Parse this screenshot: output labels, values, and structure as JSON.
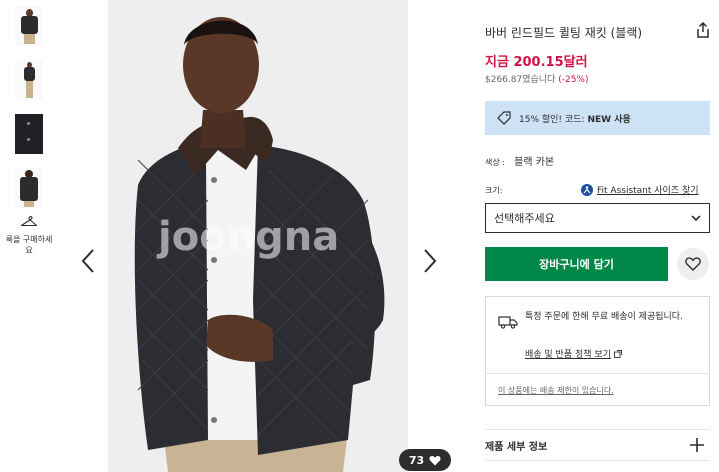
{
  "gallery": {
    "thumbnails": [
      {
        "alt": "thumbnail-front"
      },
      {
        "alt": "thumbnail-full"
      },
      {
        "alt": "thumbnail-detail"
      },
      {
        "alt": "thumbnail-back"
      }
    ],
    "buy_the_look": "룩을 구매하세요",
    "likes_count": "73",
    "watermark": "joongna"
  },
  "product": {
    "title": "바버 린드필드 퀼팅 재킷 (블랙)",
    "price_now": "지금 200.15달러",
    "price_was": "$266.87였습니다",
    "discount": "(-25%)",
    "promo_text": "15% 할인! 코드:",
    "promo_code": "NEW 사용",
    "colour_label": "색상 :",
    "colour_value": "블랙 카본",
    "size_label": "크기:",
    "fit_assistant": "Fit Assistant 사이즈 찾기",
    "size_select": "선택해주세요",
    "add_to_bag": "장바구니에 담기",
    "delivery_message": "특정 주문에 한해 무료 배송이 제공됩니다.",
    "delivery_policy": "배송 및 반품 정책 보기",
    "delivery_restriction": "이 상품에는 배송 제한이 있습니다.",
    "details_header": "제품 세부 정보"
  },
  "colors": {
    "price_red": "#d01345",
    "button_green": "#018849",
    "promo_blue": "#cde2f5"
  }
}
